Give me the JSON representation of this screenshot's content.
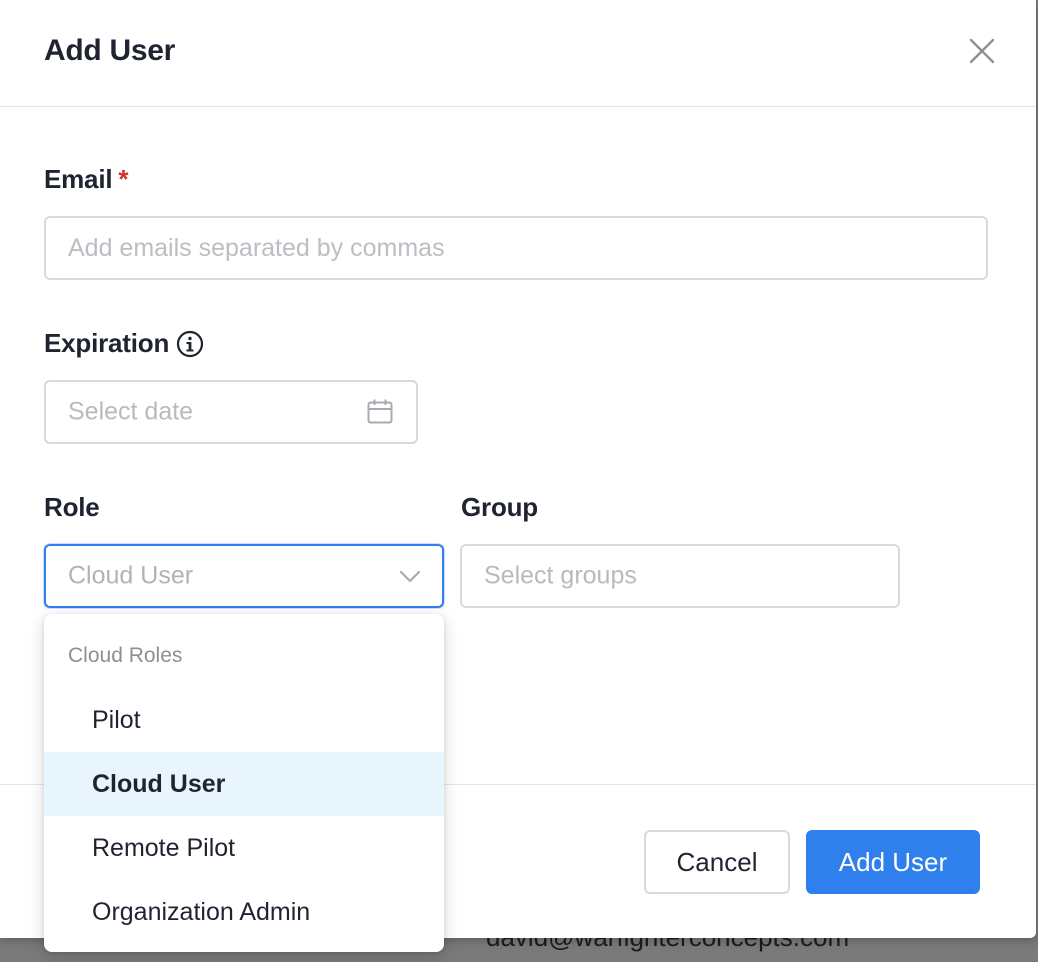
{
  "background": {
    "email_text": "david@warfighterconcepts.com"
  },
  "modal": {
    "title": "Add User",
    "close_icon": "close-icon"
  },
  "form": {
    "email": {
      "label": "Email",
      "required_mark": "*",
      "placeholder": "Add emails separated by commas",
      "value": ""
    },
    "expiration": {
      "label": "Expiration",
      "info_icon": "info-icon",
      "placeholder": "Select date",
      "calendar_icon": "calendar-icon"
    },
    "role": {
      "label": "Role",
      "selected_value": "Cloud User",
      "chevron_icon": "chevron-down-icon"
    },
    "group": {
      "label": "Group",
      "placeholder": "Select groups"
    }
  },
  "role_dropdown": {
    "group_label": "Cloud Roles",
    "options": [
      {
        "label": "Pilot",
        "selected": false
      },
      {
        "label": "Cloud User",
        "selected": true
      },
      {
        "label": "Remote Pilot",
        "selected": false
      },
      {
        "label": "Organization Admin",
        "selected": false
      }
    ]
  },
  "footer": {
    "cancel_label": "Cancel",
    "submit_label": "Add User"
  },
  "colors": {
    "primary": "#2f80ed",
    "required": "#d4302b",
    "selected_option_bg": "#e8f5fd"
  }
}
